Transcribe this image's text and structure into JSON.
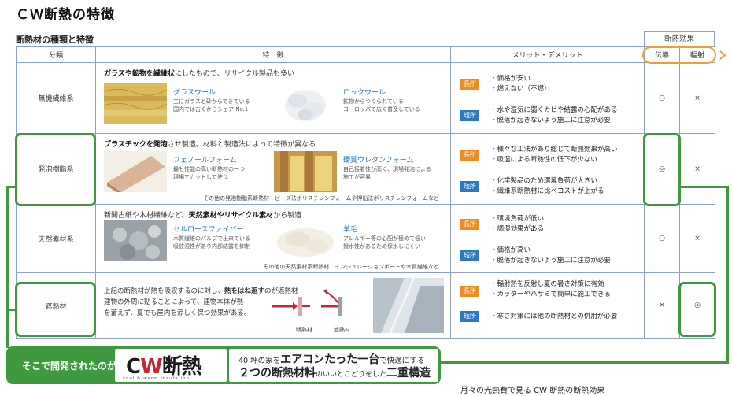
{
  "title": "ＣＷ断熱の特徴",
  "section_title": "断熱材の種類と特徴",
  "effect_header": "断熱効果",
  "columns": {
    "category": "分類",
    "features": "特　徴",
    "merits": "メリット・デメリット",
    "conduction": "伝導",
    "radiation": "輻射"
  },
  "labels": {
    "merit": "長所",
    "demerit": "短所"
  },
  "rows": [
    {
      "category": "無機繊維系",
      "head_bold": "ガラスや鉱物を繊維状",
      "head_rest": "にしたもので、リサイクル製品も多い",
      "mat1": {
        "name": "グラスウール",
        "desc1": "主にガラスと砂からできている",
        "desc2": "国内では古くからシェア No.1"
      },
      "mat2": {
        "name": "ロックウール",
        "desc1": "鉱物からつくられている",
        "desc2": "ヨーロッパで広く普及している"
      },
      "note": "",
      "merits": [
        "価格が安い",
        "燃えない（不燃）"
      ],
      "demerits": [
        "水や湿気に弱くカビや結露の心配がある",
        "脱落が起きないよう施工に注意が必要"
      ],
      "conduction": "○",
      "radiation": "×"
    },
    {
      "category": "発泡樹脂系",
      "head_bold": "プラスチックを発泡",
      "head_rest": "させ製造。材料と製造法によって特徴が異なる",
      "mat1": {
        "name": "フェノールフォーム",
        "desc1": "最も性能の高い断熱材の一つ",
        "desc2": "現場でカットして使う"
      },
      "mat2": {
        "name": "硬質ウレタンフォーム",
        "desc1": "自己接着性が高く、現場発泡による",
        "desc2": "施工が容易"
      },
      "note": "その他の発泡樹脂系断熱材　ビーズ法ポリスチレンフォームや押出法ポリスチレンフォームなど",
      "merits": [
        "様々な工法があり総じて断熱効果が高い",
        "吸湿による断熱性の低下が少ない"
      ],
      "demerits": [
        "化学製品のため環境負荷が大きい",
        "繊維系断熱材に比べコストが上がる"
      ],
      "conduction": "◎",
      "radiation": "×"
    },
    {
      "category": "天然素材系",
      "head_bold": "",
      "head_pre": "新聞古紙や木材繊維など、",
      "head_bold2": "天然素材やリサイクル素材",
      "head_rest": "から製造",
      "mat1": {
        "name": "セルロースファイバー",
        "desc1": "木質繊維のパルプで出来ている",
        "desc2": "吸放湿性があり内部結露を抑制"
      },
      "mat2": {
        "name": "羊毛",
        "desc1": "アレルギー等の心配が極めて低い",
        "desc2": "撥水性があるため保水しにくい"
      },
      "note": "その他の天然素材系断熱材　インシュレーションボードや木質繊維など",
      "merits": [
        "環境負荷が低い",
        "調湿効果がある"
      ],
      "demerits": [
        "価格が高い",
        "脱落が起きないよう施工に注意が必要"
      ],
      "conduction": "○",
      "radiation": "×"
    },
    {
      "category": "遮熱材",
      "text1_pre": "上記の断熱材が熱を吸収するのに対し、",
      "text1_bold": "熱をはね返す",
      "text1_post": "のが遮熱材",
      "text2": "建物の外周に貼ることによって、建物本体が熱",
      "text3": "を蓄えず、夏でも屋内を涼しく保つ効果がある。",
      "diag1": "断熱材",
      "diag2": "遮熱材",
      "merits": [
        "輻射熱を反射し夏の暑さ対策に有効",
        "カッターやハサミで簡単に施工できる"
      ],
      "demerits": [
        "寒さ対策には他の断熱材との併用が必要"
      ],
      "conduction": "×",
      "radiation": "◎"
    }
  ],
  "banner": {
    "lead": "そこで開発されたのが",
    "logo_main_c": "C",
    "logo_main_w": "W",
    "logo_main_rest": "断熱",
    "logo_sub": "cool & warm insulation",
    "l1_pre": "40 坪の家を",
    "l1_bold": "エアコンたった一台",
    "l1_post": "で快適にする",
    "l2_bold": "２つの断熱材料",
    "l2_mid": "のいいとこどりをした",
    "l2_bold2": "二重構造"
  },
  "caption": "月々の光熱費で見る CW 断熱の断熱効果"
}
